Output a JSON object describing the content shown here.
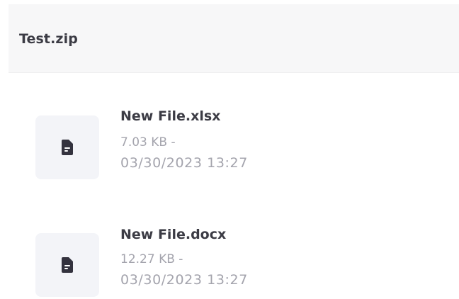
{
  "archive": {
    "title": "Test.zip"
  },
  "files": [
    {
      "name": "New File.xlsx",
      "size": "7.03 KB -",
      "modified": "03/30/2023 13:27",
      "icon": "document-icon"
    },
    {
      "name": "New File.docx",
      "size": "12.27 KB -",
      "modified": "03/30/2023 13:27",
      "icon": "document-icon"
    }
  ],
  "colors": {
    "header_bg": "#f7f7f8",
    "title_text": "#3b3b44",
    "meta_text": "#a4a4ad",
    "thumb_bg": "#f3f4f8",
    "icon_fill": "#33323e"
  }
}
